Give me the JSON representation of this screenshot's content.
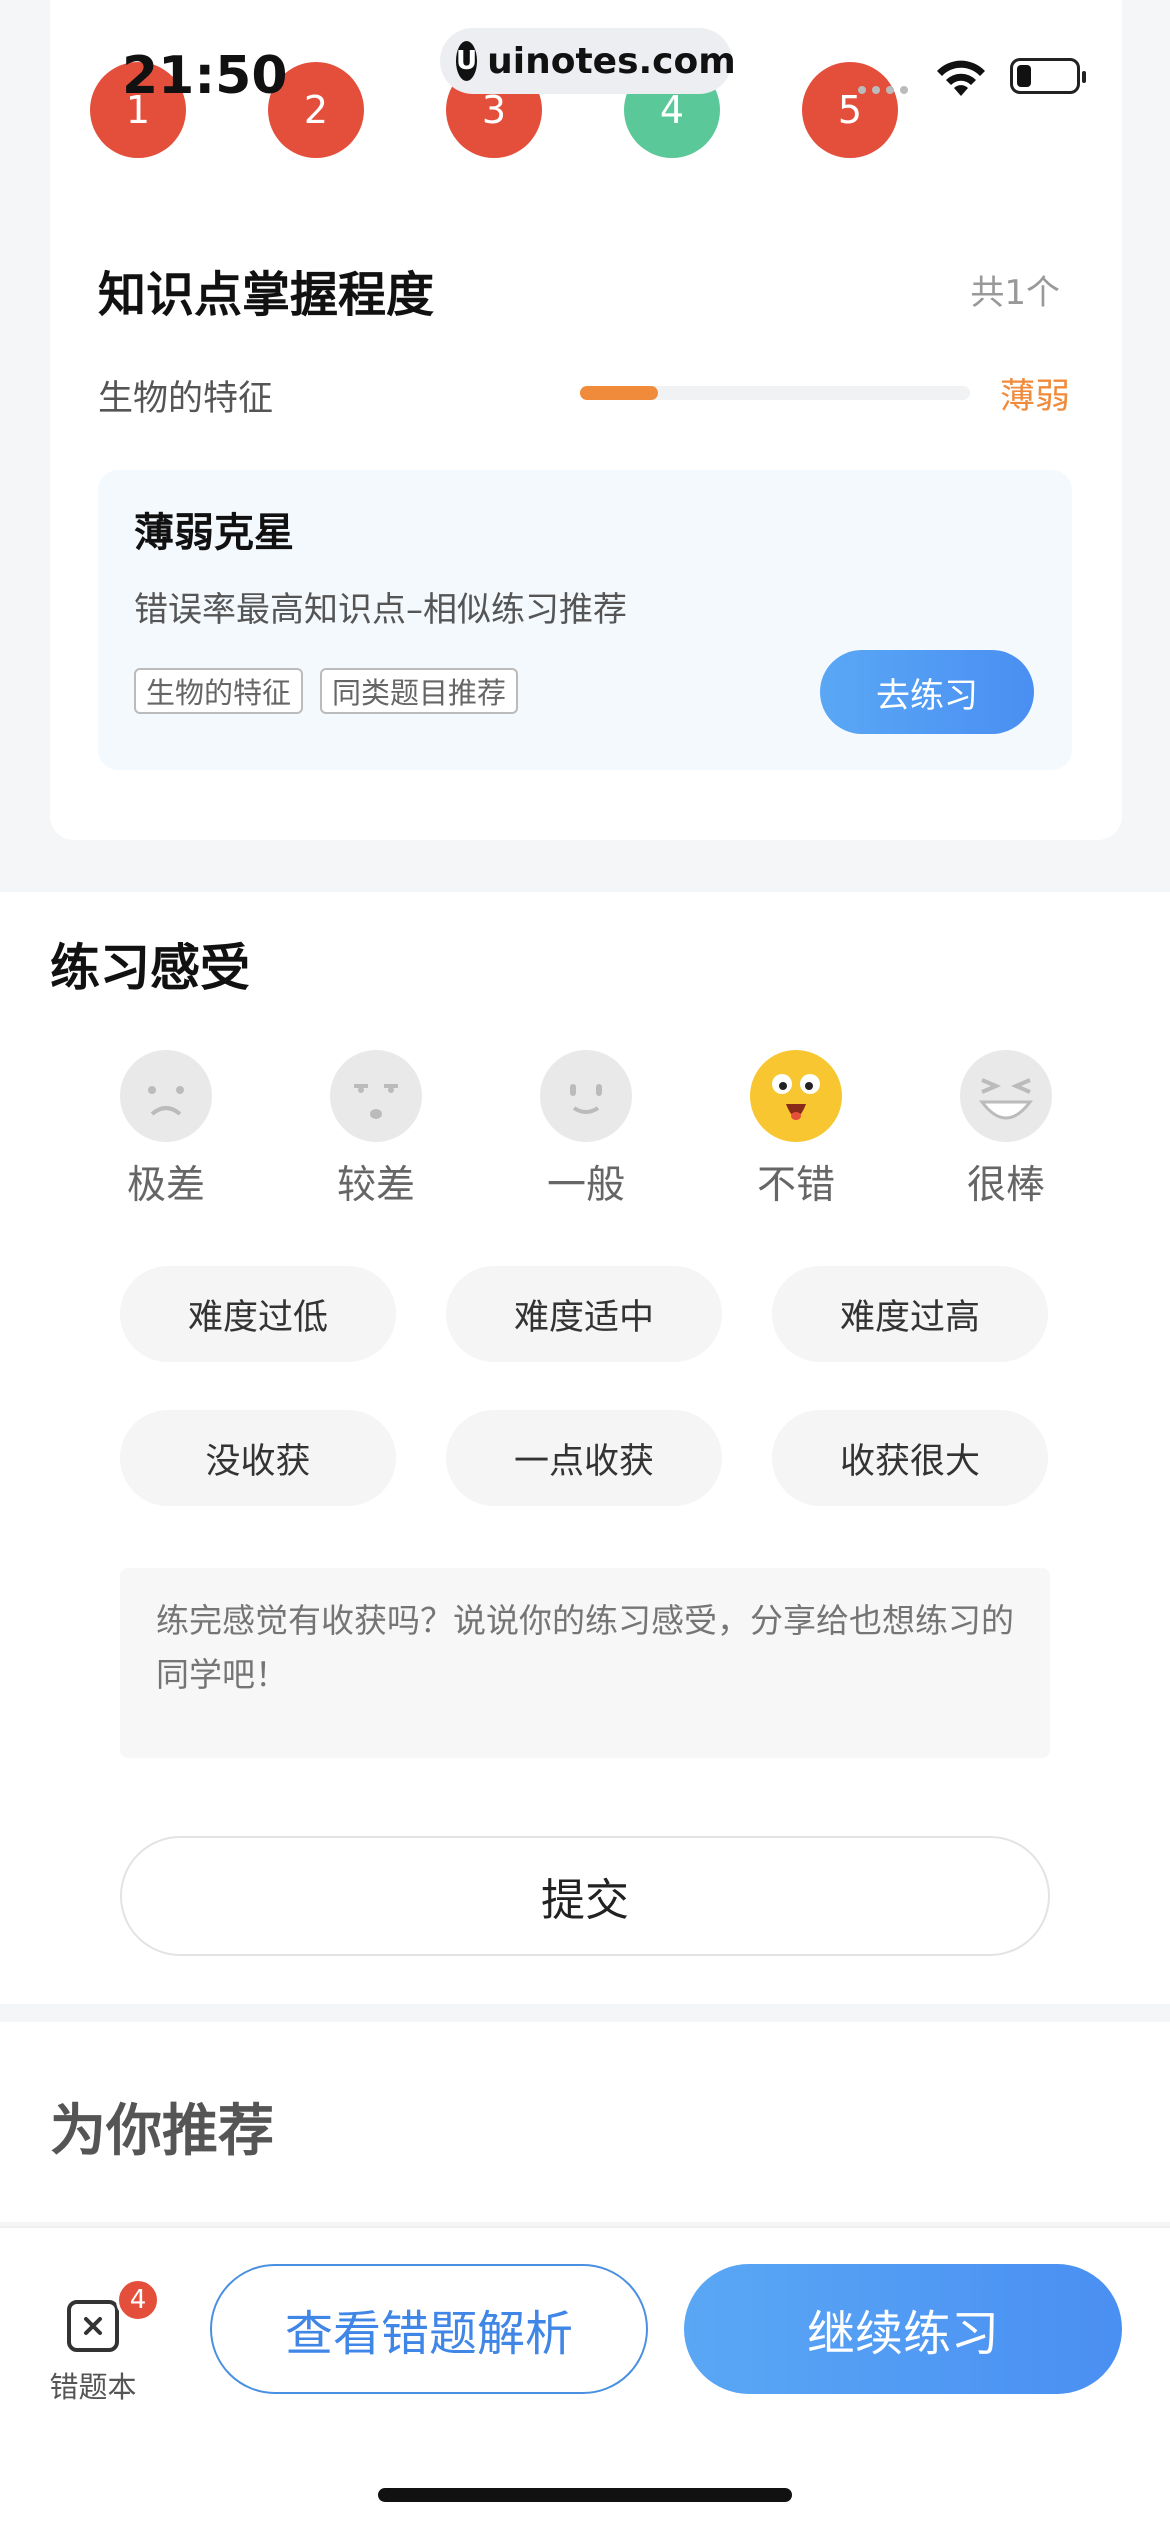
{
  "status_bar": {
    "time": "21:50",
    "url": "uinotes.com",
    "url_logo": "U"
  },
  "questions": [
    {
      "num": "1",
      "state": "wrong",
      "color": "#e44f3c"
    },
    {
      "num": "2",
      "state": "wrong",
      "color": "#e44f3c"
    },
    {
      "num": "3",
      "state": "wrong",
      "color": "#e44f3c"
    },
    {
      "num": "4",
      "state": "right",
      "color": "#5bc89a"
    },
    {
      "num": "5",
      "state": "wrong",
      "color": "#e44f3c"
    }
  ],
  "knowledge": {
    "title": "知识点掌握程度",
    "count": "共1个",
    "item_name": "生物的特征",
    "item_progress": 0.2,
    "item_level": "薄弱",
    "level_color": "#f08b3c"
  },
  "weak_box": {
    "title": "薄弱克星",
    "desc": "错误率最高知识点–相似练习推荐",
    "tags": [
      "生物的特征",
      "同类题目推荐"
    ],
    "button": "去练习"
  },
  "feel": {
    "title": "练习感受",
    "ratings": [
      {
        "label": "极差",
        "icon": "sad-face-icon",
        "selected": false
      },
      {
        "label": "较差",
        "icon": "surprised-face-icon",
        "selected": false
      },
      {
        "label": "一般",
        "icon": "neutral-face-icon",
        "selected": false
      },
      {
        "label": "不错",
        "icon": "happy-face-icon",
        "selected": true
      },
      {
        "label": "很棒",
        "icon": "laughing-face-icon",
        "selected": false
      }
    ],
    "chips": [
      "难度过低",
      "难度适中",
      "难度过高",
      "没收获",
      "一点收获",
      "收获很大"
    ],
    "placeholder": "练完感觉有收获吗？说说你的练习感受，分享给也想练习的同学吧！",
    "submit": "提交"
  },
  "recommend": {
    "title": "为你推荐"
  },
  "bottom": {
    "wrongbook_label": "错题本",
    "wrongbook_badge": "4",
    "view_analysis": "查看错题解析",
    "continue": "继续练习",
    "accent": "#4a8ff2"
  }
}
